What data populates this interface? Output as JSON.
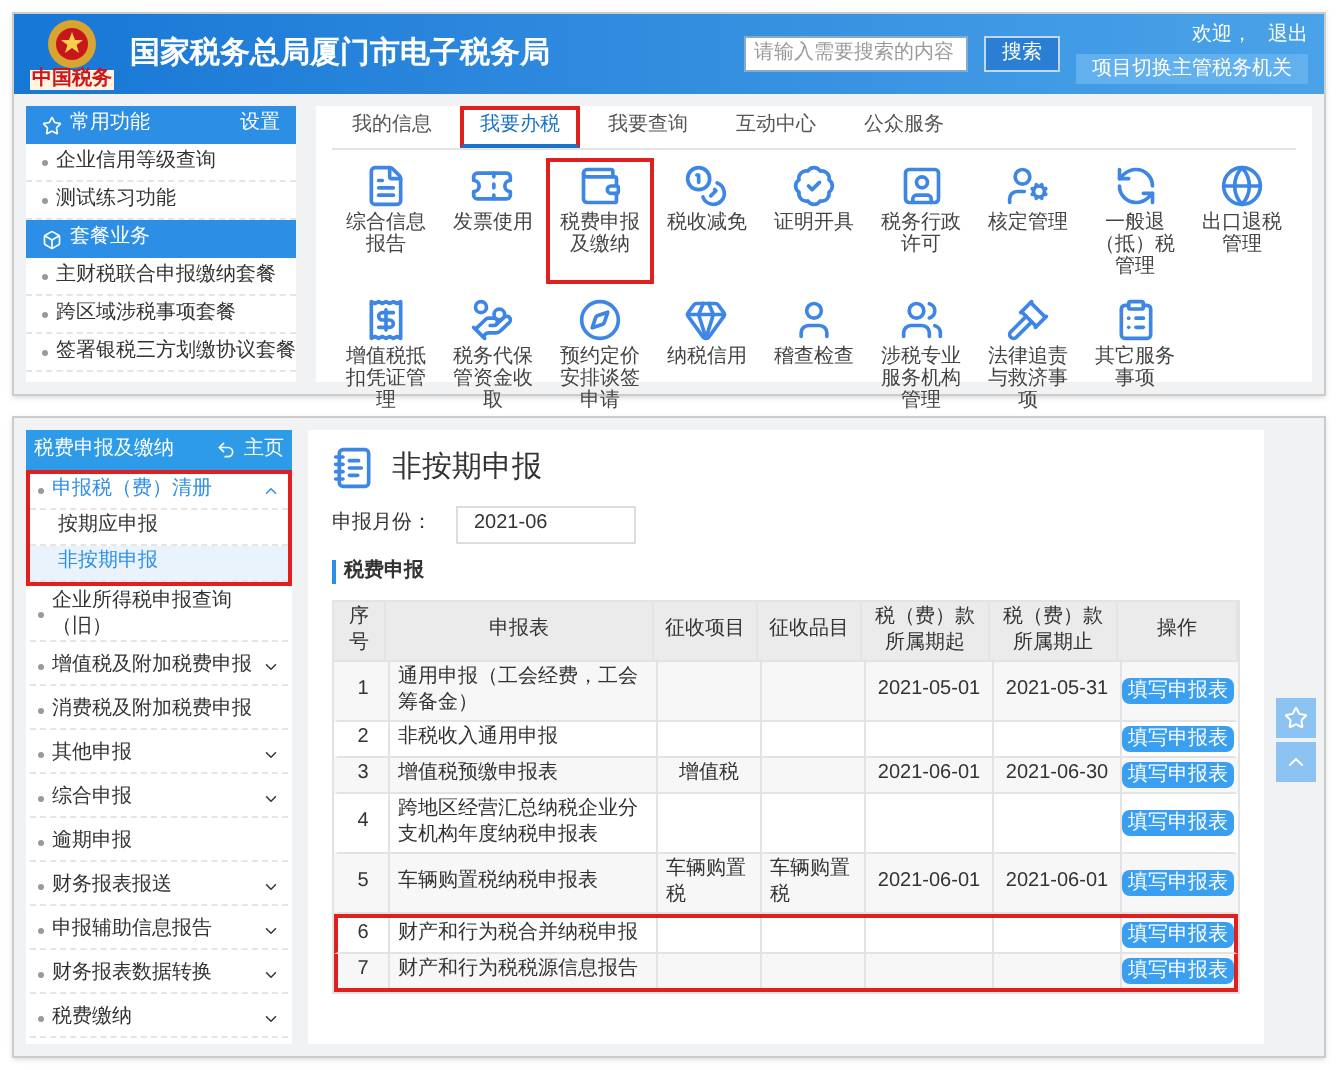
{
  "header": {
    "logo_text": "中国税务",
    "title": "国家税务总局厦门市电子税务局",
    "search": {
      "placeholder": "请输入需要搜索的内容",
      "button": "搜索"
    },
    "welcome": "欢迎，",
    "logout": "退出",
    "switch_button": "项目切换主管税务机关"
  },
  "portal_sidebar": [
    {
      "title": "常用功能",
      "action": "设置",
      "items": [
        "企业信用等级查询",
        "测试练习功能"
      ]
    },
    {
      "title": "套餐业务",
      "items": [
        "主财税联合申报缴纳套餐",
        "跨区域涉税事项套餐",
        "签署银税三方划缴协议套餐"
      ]
    }
  ],
  "tabs": [
    {
      "label": "我的信息",
      "selected": false,
      "highlighted": false
    },
    {
      "label": "我要办税",
      "selected": true,
      "highlighted": true
    },
    {
      "label": "我要查询",
      "selected": false,
      "highlighted": false
    },
    {
      "label": "互动中心",
      "selected": false,
      "highlighted": false
    },
    {
      "label": "公众服务",
      "selected": false,
      "highlighted": false
    }
  ],
  "services": [
    {
      "label": "综合信息报告",
      "highlighted": false
    },
    {
      "label": "发票使用",
      "highlighted": false
    },
    {
      "label": "税费申报及缴纳",
      "highlighted": true
    },
    {
      "label": "税收减免",
      "highlighted": false
    },
    {
      "label": "证明开具",
      "highlighted": false
    },
    {
      "label": "税务行政许可",
      "highlighted": false
    },
    {
      "label": "核定管理",
      "highlighted": false
    },
    {
      "label": "一般退（抵）税管理",
      "highlighted": false
    },
    {
      "label": "出口退税管理",
      "highlighted": false
    },
    {
      "label": "增值税抵扣凭证管理",
      "highlighted": false
    },
    {
      "label": "税务代保管资金收取",
      "highlighted": false
    },
    {
      "label": "预约定价安排谈签申请",
      "highlighted": false
    },
    {
      "label": "纳税信用",
      "highlighted": false
    },
    {
      "label": "稽查检查",
      "highlighted": false
    },
    {
      "label": "涉税专业服务机构管理",
      "highlighted": false
    },
    {
      "label": "法律追责与救济事项",
      "highlighted": false
    },
    {
      "label": "其它服务事项",
      "highlighted": false
    }
  ],
  "filing_sidebar": {
    "title": "税费申报及缴纳",
    "home": "主页",
    "items": [
      {
        "label": "申报税（费）清册",
        "kind": "group",
        "expanded": true,
        "highlighted": true,
        "children": [
          {
            "label": "按期应申报",
            "selected": false
          },
          {
            "label": "非按期申报",
            "selected": true
          }
        ]
      },
      {
        "label": "企业所得税申报查询（旧）",
        "kind": "link",
        "highlighted": false
      },
      {
        "label": "增值税及附加税费申报",
        "kind": "group",
        "expanded": false,
        "highlighted": false
      },
      {
        "label": "消费税及附加税费申报",
        "kind": "link",
        "highlighted": false
      },
      {
        "label": "其他申报",
        "kind": "group",
        "expanded": false,
        "highlighted": false
      },
      {
        "label": "综合申报",
        "kind": "group",
        "expanded": false,
        "highlighted": false
      },
      {
        "label": "逾期申报",
        "kind": "link",
        "highlighted": false
      },
      {
        "label": "财务报表报送",
        "kind": "group",
        "expanded": false,
        "highlighted": false
      },
      {
        "label": "申报辅助信息报告",
        "kind": "group",
        "expanded": false,
        "highlighted": false
      },
      {
        "label": "财务报表数据转换",
        "kind": "group",
        "expanded": false,
        "highlighted": false
      },
      {
        "label": "税费缴纳",
        "kind": "group",
        "expanded": false,
        "highlighted": false
      }
    ]
  },
  "filing": {
    "title": "非按期申报",
    "month_label": "申报月份：",
    "month_value": "2021-06",
    "section": "税费申报",
    "table": {
      "columns": [
        "序号",
        "申报表",
        "征收项目",
        "征收品目",
        "税（费）款所属期起",
        "税（费）款所属期止",
        "操作"
      ],
      "rows": [
        {
          "cells": [
            "1",
            "通用申报（工会经费，工会筹备金）",
            "",
            "",
            "2021-05-01",
            "2021-05-31"
          ],
          "action": "填写申报表",
          "highlighted": false
        },
        {
          "cells": [
            "2",
            "非税收入通用申报",
            "",
            "",
            "",
            ""
          ],
          "action": "填写申报表",
          "highlighted": false
        },
        {
          "cells": [
            "3",
            "增值税预缴申报表",
            "增值税",
            "",
            "2021-06-01",
            "2021-06-30"
          ],
          "action": "填写申报表",
          "highlighted": false
        },
        {
          "cells": [
            "4",
            "跨地区经营汇总纳税企业分支机构年度纳税申报表",
            "",
            "",
            "",
            ""
          ],
          "action": "填写申报表",
          "highlighted": false
        },
        {
          "cells": [
            "5",
            "车辆购置税纳税申报表",
            "车辆购置税",
            "车辆购置税",
            "2021-06-01",
            "2021-06-01"
          ],
          "action": "填写申报表",
          "highlighted": false
        },
        {
          "cells": [
            "6",
            "财产和行为税合并纳税申报",
            "",
            "",
            "",
            ""
          ],
          "action": "填写申报表",
          "highlighted": true
        },
        {
          "cells": [
            "7",
            "财产和行为税税源信息报告",
            "",
            "",
            "",
            ""
          ],
          "action": "填写申报表",
          "highlighted": true
        }
      ]
    }
  }
}
